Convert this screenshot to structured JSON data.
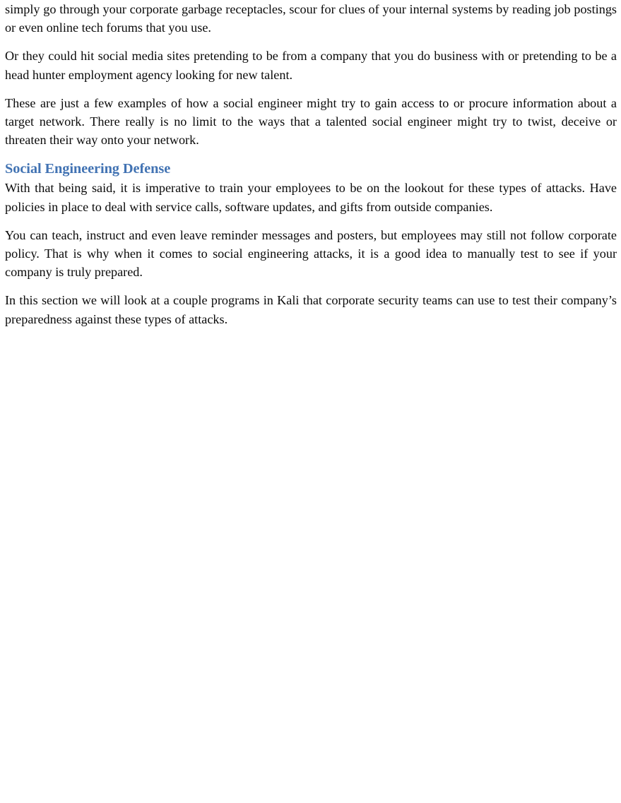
{
  "document": {
    "page_background": "#ffffff",
    "body_text_color": "#0a0a0a",
    "heading_color": "#4273b3",
    "paragraphs": {
      "p1": "simply go through your corporate garbage receptacles, scour for clues of your internal systems by reading job postings or even online tech forums that you use.",
      "p2": "Or they could hit social media sites pretending to be from a company that you do business with or pretending to be a head hunter employment agency looking for new talent.",
      "p3": "These are just a few examples of how a social engineer might try to gain access to or procure information about a target network. There really is no limit to the ways that a talented social engineer might try to twist, deceive or threaten their way onto your network.",
      "p4": "With that being said, it is imperative to train your employees to be on the lookout for these types of attacks. Have policies in place to deal with service calls, software updates, and gifts from outside companies.",
      "p5": "You can teach, instruct and even leave reminder messages and posters, but employees may still not follow corporate policy. That is why when it comes to social engineering attacks, it is a good idea to manually test to see if your company is truly prepared.",
      "p6": "In this section we will look at a couple programs in Kali that corporate security teams can use to test their company’s preparedness against these types of attacks."
    },
    "heading": {
      "social_engineering_defense": "Social Engineering Defense"
    }
  }
}
